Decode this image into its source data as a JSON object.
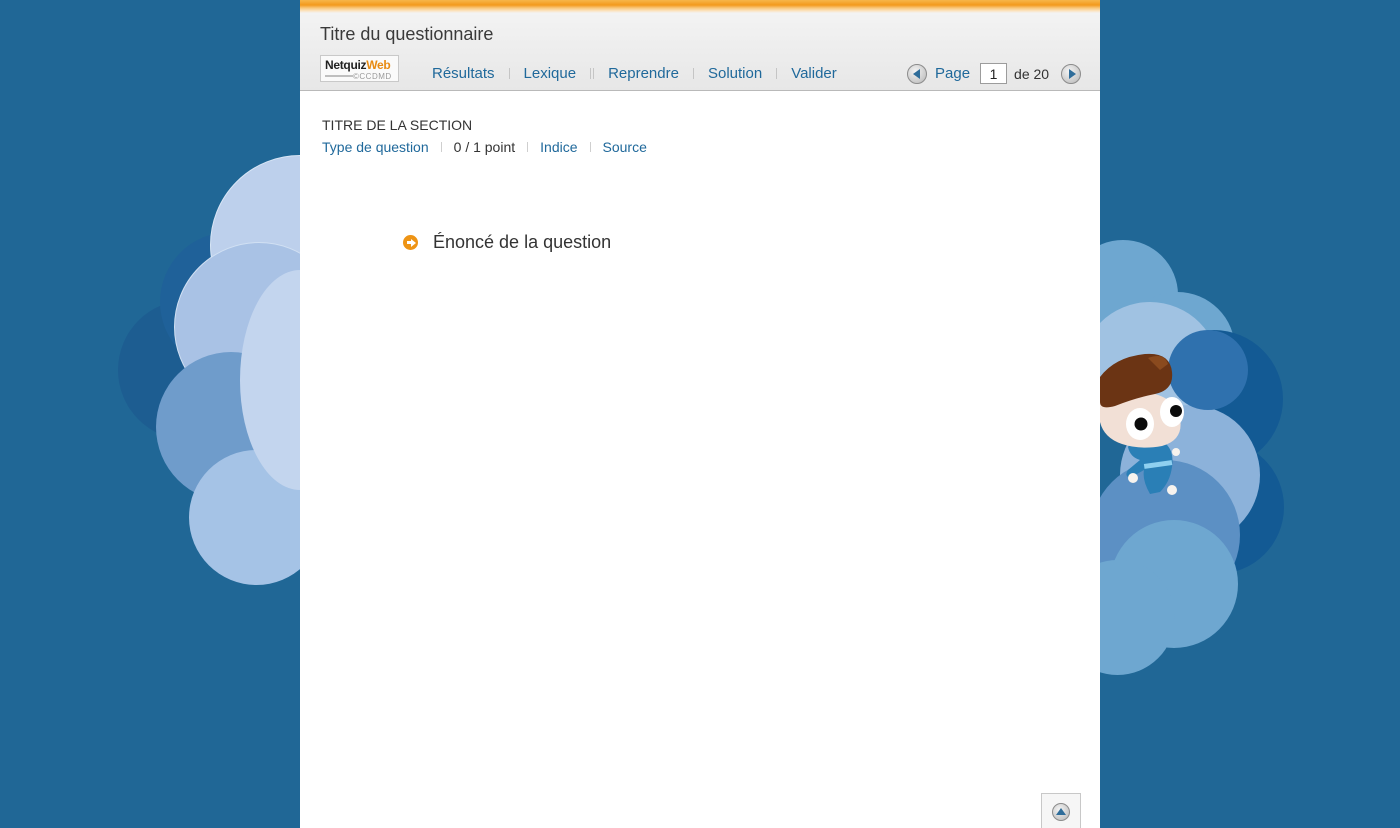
{
  "header": {
    "quiz_title": "Titre du questionnaire",
    "logo": {
      "brand_a": "Netquiz",
      "brand_b": "Web",
      "publisher": "©CCDMD"
    },
    "menu": [
      "Résultats",
      "Lexique",
      "Reprendre",
      "Solution",
      "Valider"
    ],
    "pager": {
      "label": "Page",
      "current": "1",
      "total_text": "de 20"
    }
  },
  "section": {
    "title": "TITRE DE LA SECTION",
    "question_type": "Type de question",
    "score": "0 / 1 point",
    "hint": "Indice",
    "source": "Source"
  },
  "question": {
    "statement": "Énoncé de la question"
  },
  "icons": {
    "prev": "arrow-left-circle-icon",
    "next": "arrow-right-circle-icon",
    "statement": "arrow-right-bullet-icon",
    "back_to_top": "arrow-up-circle-icon"
  },
  "colors": {
    "background": "#206796",
    "accent_orange": "#ee9415",
    "link_blue": "#20699b"
  }
}
